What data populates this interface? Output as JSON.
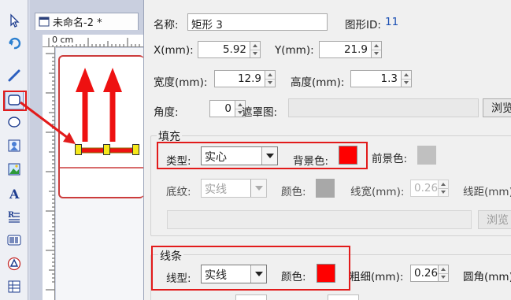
{
  "canvas": {
    "tab_title": "未命名-2 *",
    "ruler_unit": "0 cm"
  },
  "properties": {
    "name_label": "名称:",
    "name_value": "矩形 3",
    "shape_id_label": "图形ID:",
    "shape_id_value": "11",
    "x_label": "X(mm):",
    "x_value": "5.92",
    "y_label": "Y(mm):",
    "y_value": "21.9",
    "width_label": "宽度(mm):",
    "width_value": "12.9",
    "height_label": "高度(mm):",
    "height_value": "1.3",
    "angle_label": "角度:",
    "angle_value": "0",
    "mask_label": "遮罩图:",
    "browse_label": "浏览"
  },
  "fill": {
    "group_title": "填充",
    "type_label": "类型:",
    "type_value": "实心",
    "bg_color_label": "背景色:",
    "bg_color": "#ff0000",
    "fg_color_label": "前景色:",
    "fg_color": "#c0c0c0",
    "pattern_label": "底纹:",
    "pattern_value": "实线",
    "color_label": "颜色:",
    "pattern_color": "#a8a8a8",
    "line_width_label": "线宽(mm):",
    "line_width_value": "0.26",
    "spacing_label": "线距(mm)",
    "browse_label": "浏览"
  },
  "line": {
    "group_title": "线条",
    "type_label": "线型:",
    "type_value": "实线",
    "color_label": "颜色:",
    "color": "#ff0000",
    "thickness_label": "粗细(mm):",
    "thickness_value": "0.26",
    "corner_label": "圆角(mm)"
  },
  "colors": {
    "annotation_red": "#e21b1b",
    "shape_red": "#ee1111",
    "handle_yellow": "#f5e81b"
  },
  "icons": [
    "pointer-icon",
    "rotate-icon",
    "line-tool-icon",
    "rectangle-tool-icon",
    "ellipse-tool-icon",
    "image-tool-icon",
    "picture-tool-icon",
    "text-tool-icon",
    "rich-text-tool-icon",
    "barcode-tool-icon",
    "qrcode-tool-icon",
    "table-tool-icon",
    "document-icon"
  ]
}
